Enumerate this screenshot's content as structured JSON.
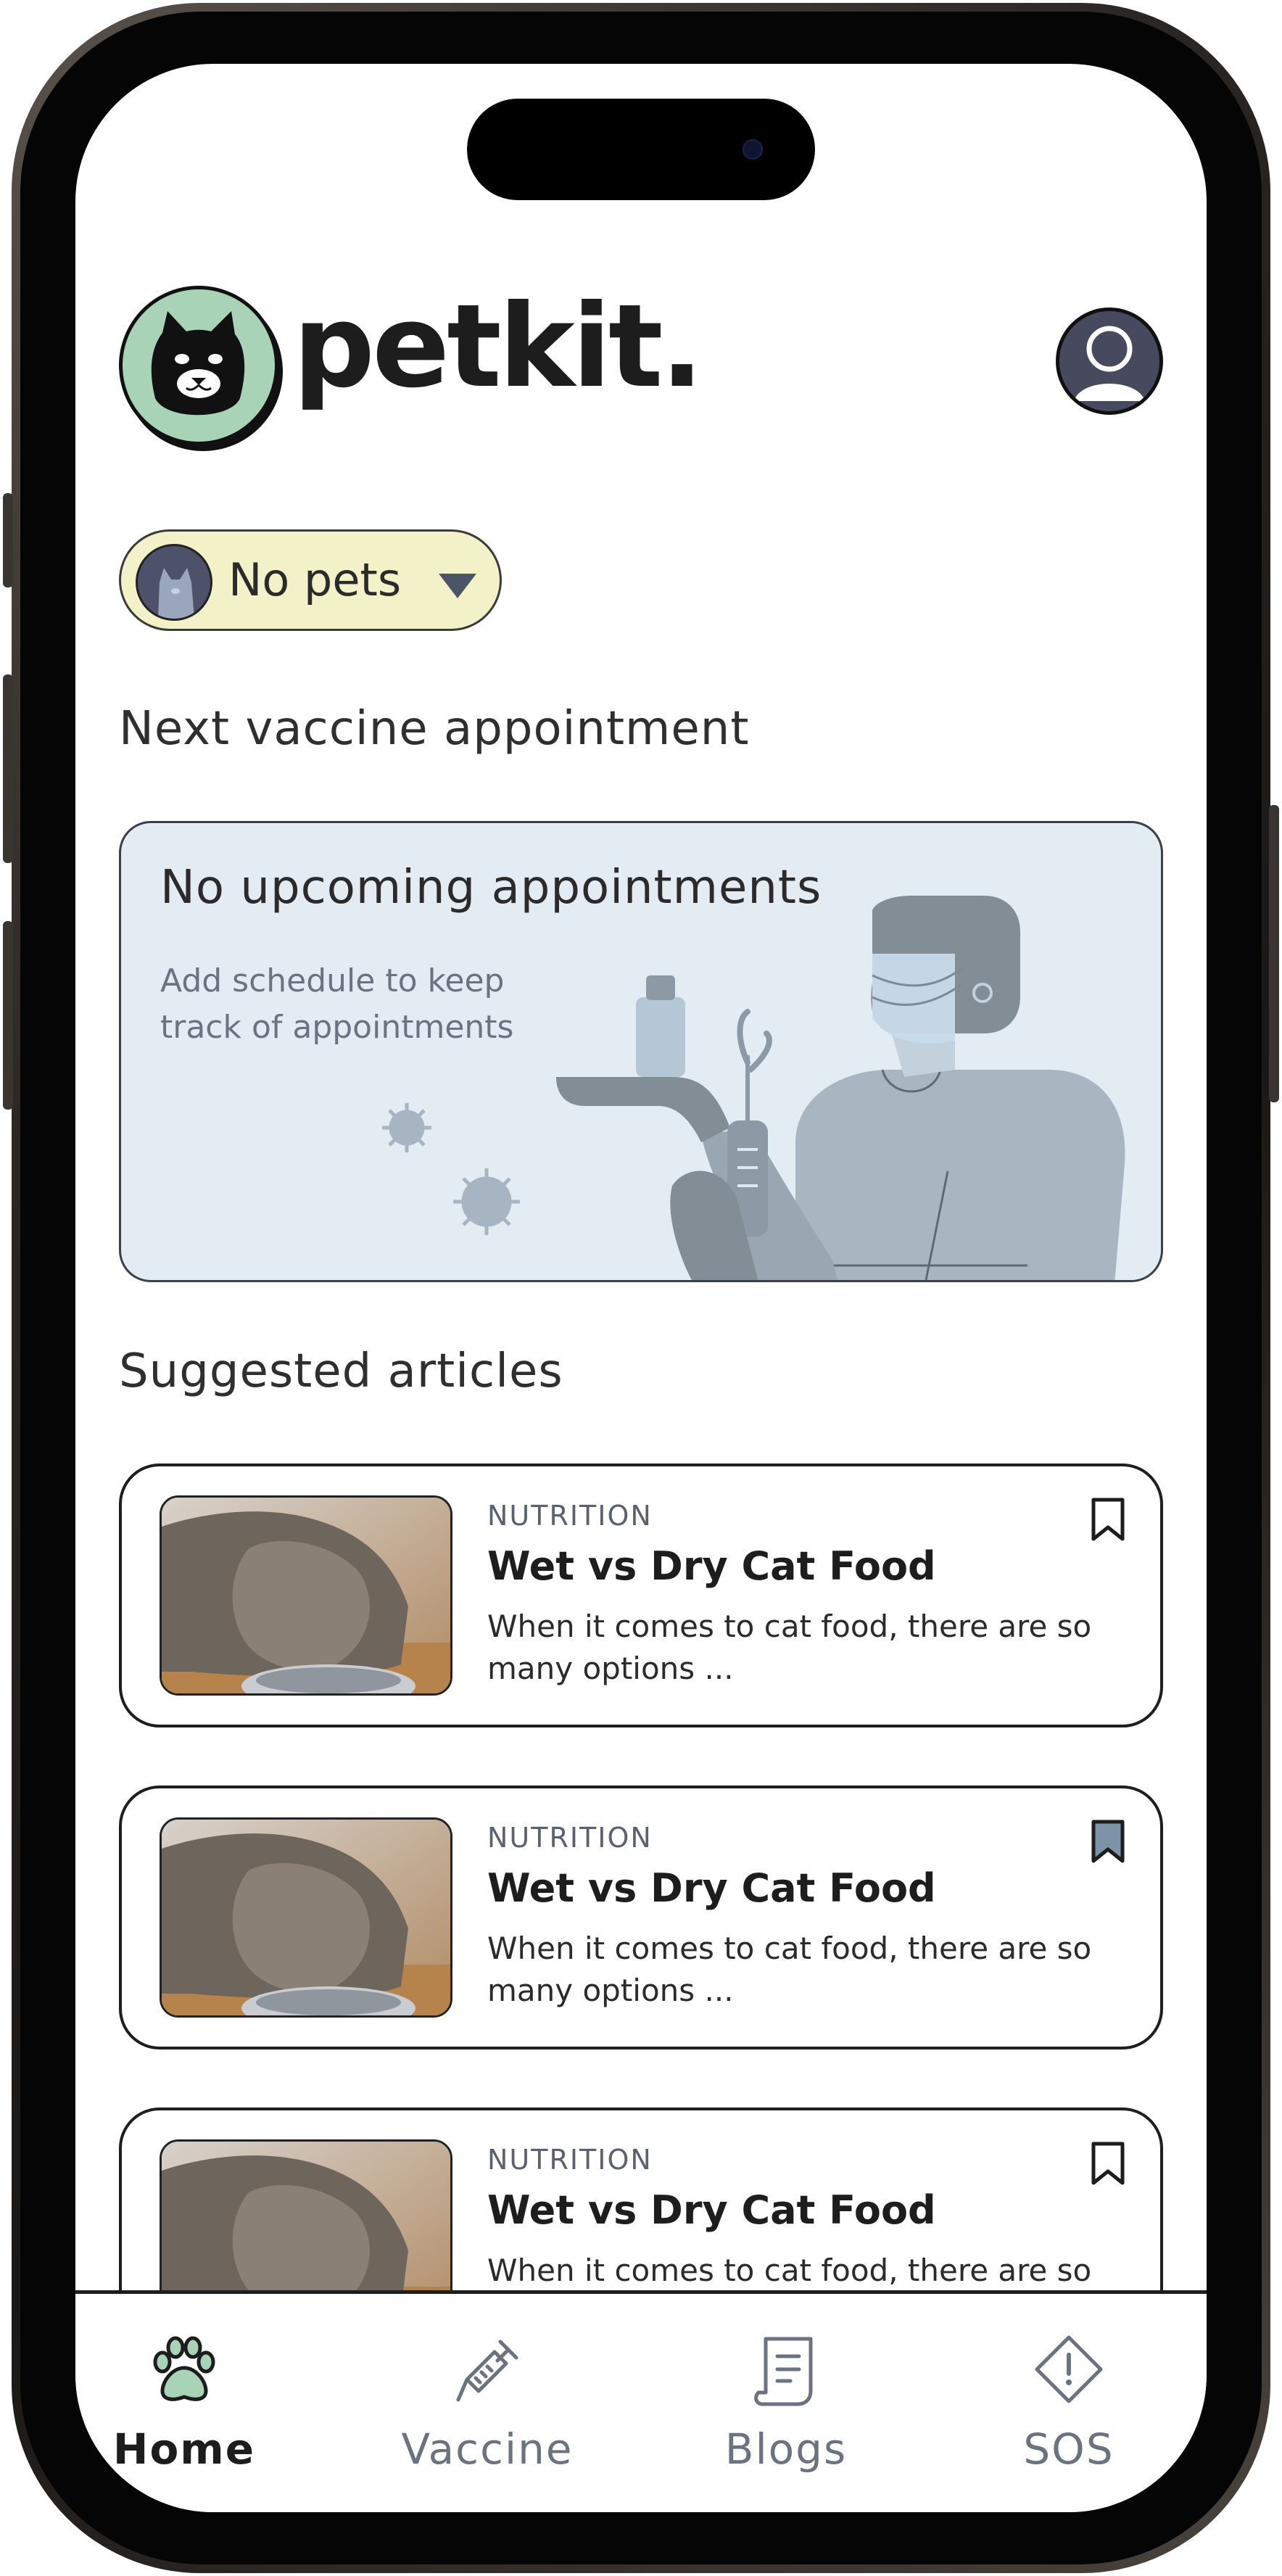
{
  "header": {
    "brand": "petkit."
  },
  "pet_selector": {
    "label": "No pets"
  },
  "appointments": {
    "section_title": "Next vaccine appointment",
    "card_title": "No upcoming appointments",
    "card_subtitle": "Add schedule to keep track of appointments"
  },
  "articles": {
    "section_title": "Suggested articles",
    "items": [
      {
        "category": "NUTRITION",
        "title": "Wet vs Dry Cat Food",
        "description": "When it comes to cat food, there are so many options ...",
        "bookmarked": false
      },
      {
        "category": "NUTRITION",
        "title": "Wet vs Dry Cat Food",
        "description": "When it comes to cat food, there are so many options ...",
        "bookmarked": true
      },
      {
        "category": "NUTRITION",
        "title": "Wet vs Dry Cat Food",
        "description": "When it comes to cat food, there are so many options ...",
        "bookmarked": false
      }
    ]
  },
  "nav": {
    "items": [
      {
        "label": "Home",
        "icon": "paw-icon",
        "active": true
      },
      {
        "label": "Vaccine",
        "icon": "syringe-icon",
        "active": false
      },
      {
        "label": "Blogs",
        "icon": "document-icon",
        "active": false
      },
      {
        "label": "SOS",
        "icon": "alert-icon",
        "active": false
      }
    ]
  },
  "colors": {
    "logo_green": "#a9d3b6",
    "pet_selector_bg": "#f3f1c7",
    "appointment_card_bg": "#e4ecf3",
    "nav_active_icon": "#a9d3b6",
    "nav_inactive": "#6b7280",
    "bookmark_filled": "#7d93a8"
  }
}
